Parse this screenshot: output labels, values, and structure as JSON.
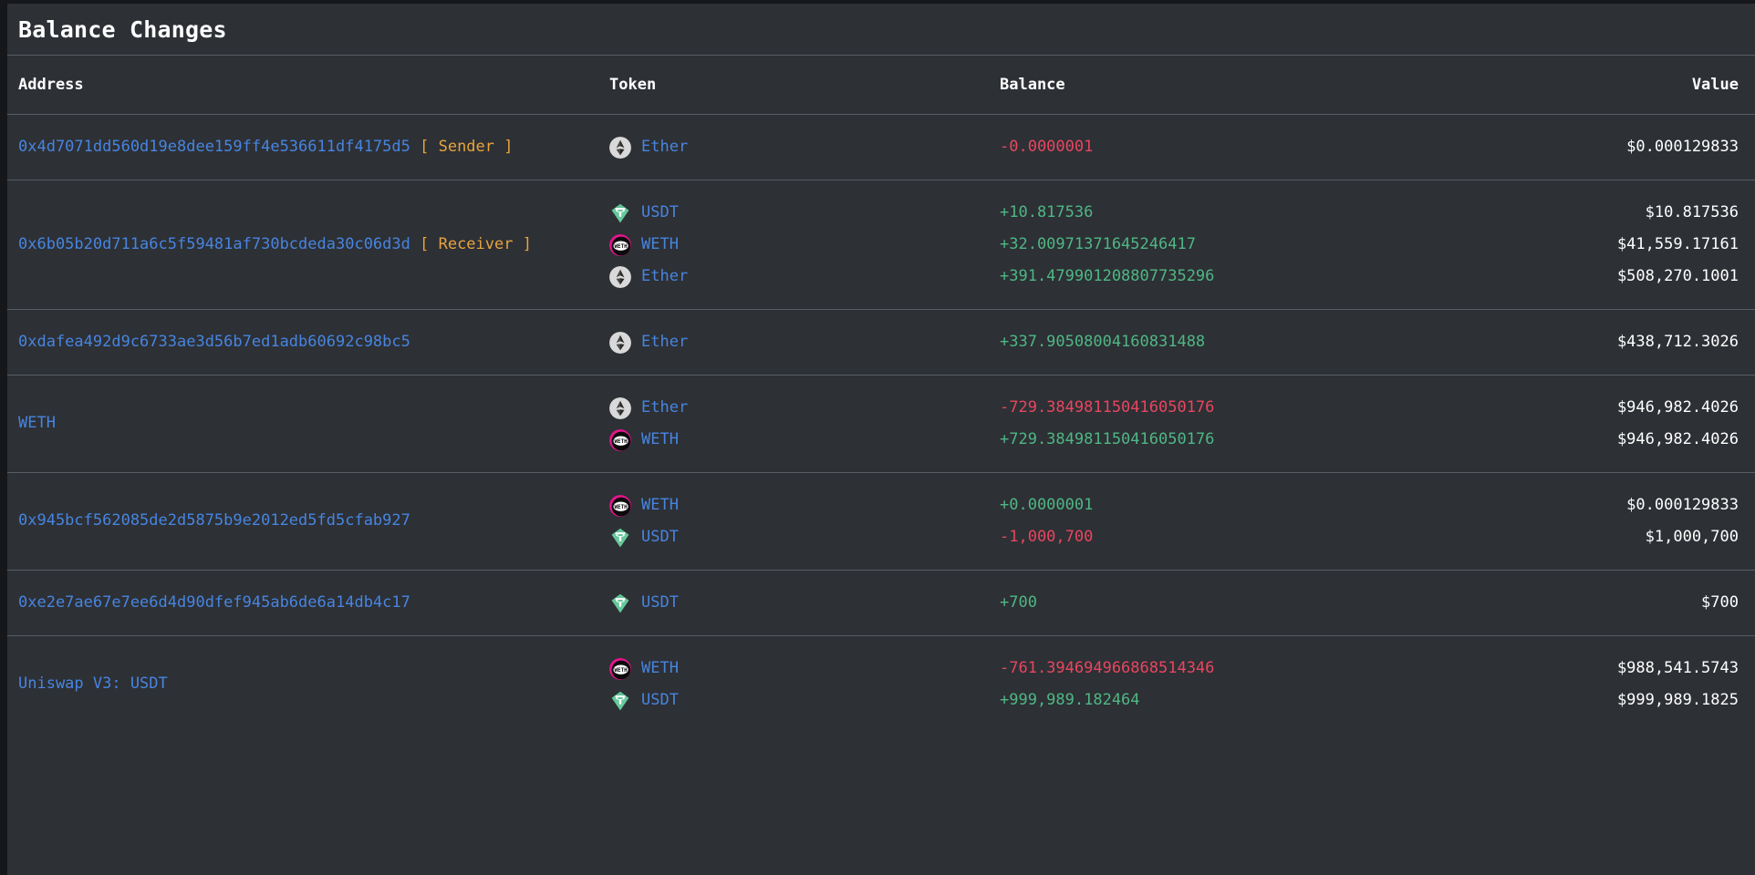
{
  "panel": {
    "title": "Balance Changes"
  },
  "table": {
    "columns": [
      {
        "key": "address",
        "label": "Address",
        "align": "left"
      },
      {
        "key": "token",
        "label": "Token",
        "align": "left"
      },
      {
        "key": "balance",
        "label": "Balance",
        "align": "left"
      },
      {
        "key": "value",
        "label": "Value",
        "align": "right"
      }
    ],
    "rows": [
      {
        "address": "0x4d7071dd560d19e8dee159ff4e536611df4175d5",
        "tag": "[ Sender ]",
        "entries": [
          {
            "icon": "ether-icon",
            "token": "Ether",
            "balance": "-0.0000001",
            "sign": "neg",
            "value": "$0.000129833"
          }
        ]
      },
      {
        "address": "0x6b05b20d711a6c5f59481af730bcdeda30c06d3d",
        "tag": "[ Receiver ]",
        "entries": [
          {
            "icon": "usdt-icon",
            "token": "USDT",
            "balance": "+10.817536",
            "sign": "pos",
            "value": "$10.817536"
          },
          {
            "icon": "weth-icon",
            "token": "WETH",
            "balance": "+32.00971371645246417",
            "sign": "pos",
            "value": "$41,559.17161"
          },
          {
            "icon": "ether-icon",
            "token": "Ether",
            "balance": "+391.479901208807735296",
            "sign": "pos",
            "value": "$508,270.1001"
          }
        ]
      },
      {
        "address": "0xdafea492d9c6733ae3d56b7ed1adb60692c98bc5",
        "tag": "",
        "entries": [
          {
            "icon": "ether-icon",
            "token": "Ether",
            "balance": "+337.90508004160831488",
            "sign": "pos",
            "value": "$438,712.3026"
          }
        ]
      },
      {
        "address": "WETH",
        "tag": "",
        "entries": [
          {
            "icon": "ether-icon",
            "token": "Ether",
            "balance": "-729.384981150416050176",
            "sign": "neg",
            "value": "$946,982.4026"
          },
          {
            "icon": "weth-icon",
            "token": "WETH",
            "balance": "+729.384981150416050176",
            "sign": "pos",
            "value": "$946,982.4026"
          }
        ]
      },
      {
        "address": "0x945bcf562085de2d5875b9e2012ed5fd5cfab927",
        "tag": "",
        "entries": [
          {
            "icon": "weth-icon",
            "token": "WETH",
            "balance": "+0.0000001",
            "sign": "pos",
            "value": "$0.000129833"
          },
          {
            "icon": "usdt-icon",
            "token": "USDT",
            "balance": "-1,000,700",
            "sign": "neg",
            "value": "$1,000,700"
          }
        ]
      },
      {
        "address": "0xe2e7ae67e7ee6d4d90dfef945ab6de6a14db4c17",
        "tag": "",
        "entries": [
          {
            "icon": "usdt-icon",
            "token": "USDT",
            "balance": "+700",
            "sign": "pos",
            "value": "$700"
          }
        ]
      },
      {
        "address": "Uniswap V3: USDT",
        "tag": "",
        "entries": [
          {
            "icon": "weth-icon",
            "token": "WETH",
            "balance": "-761.394694966868514346",
            "sign": "neg",
            "value": "$988,541.5743"
          },
          {
            "icon": "usdt-icon",
            "token": "USDT",
            "balance": "+999,989.182464",
            "sign": "pos",
            "value": "$999,989.1825"
          }
        ]
      }
    ]
  },
  "colors": {
    "page_background": "#15171a",
    "card_background": "#2d3035",
    "separator": "#585d65",
    "link_blue": "#4785e0",
    "tag_orange": "#e8a33d",
    "positive_green": "#4fb784",
    "negative_red": "#e8465f",
    "text_white": "#ffffff"
  }
}
